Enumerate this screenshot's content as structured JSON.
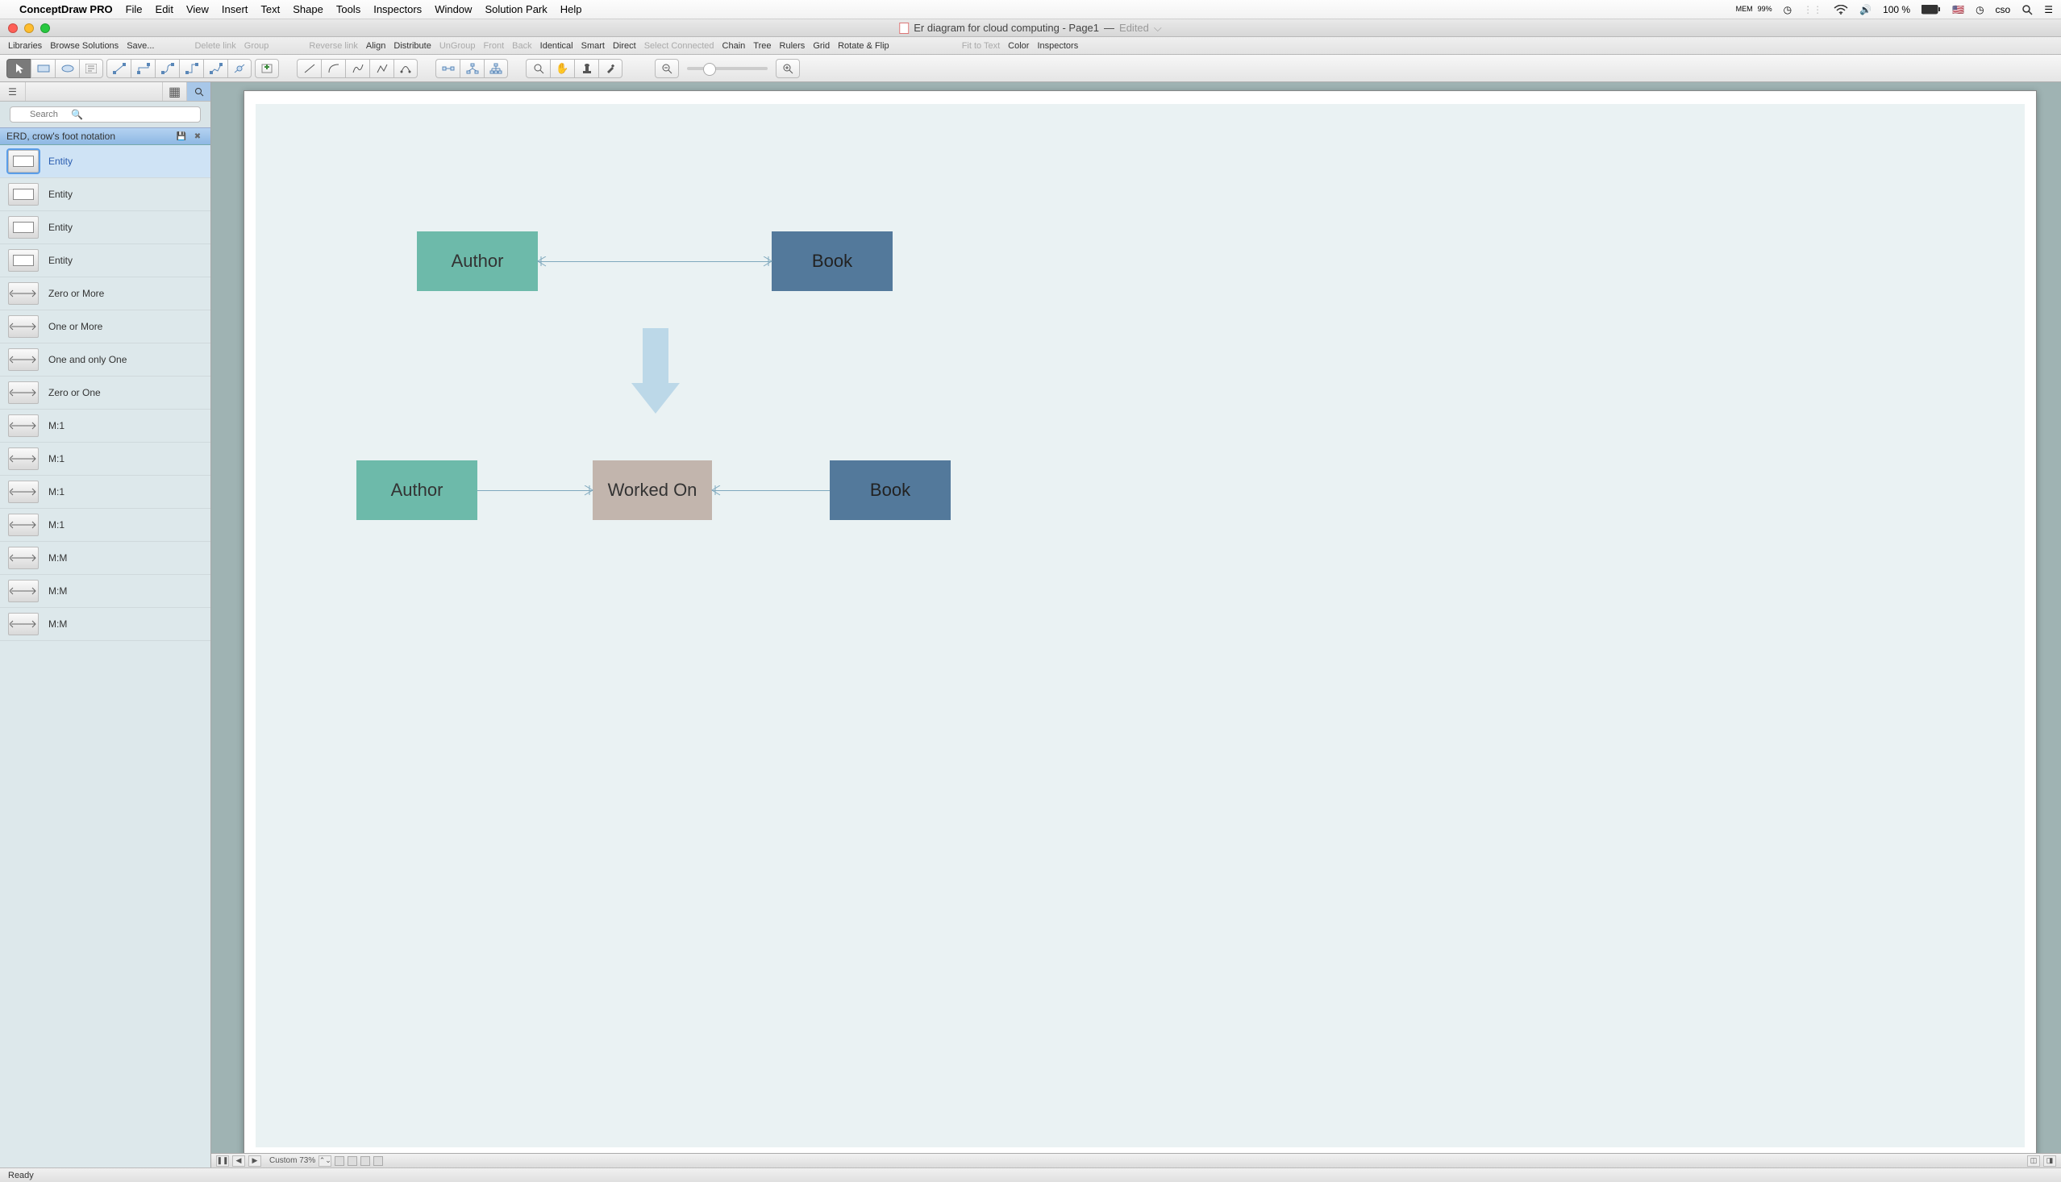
{
  "menubar": {
    "appname": "ConceptDraw PRO",
    "items": [
      "File",
      "Edit",
      "View",
      "Insert",
      "Text",
      "Shape",
      "Tools",
      "Inspectors",
      "Window",
      "Solution Park",
      "Help"
    ],
    "mem_label": "MEM",
    "mem_value": "99%",
    "battery_pct": "100 %",
    "user": "cso"
  },
  "titlebar": {
    "doc_name": "Er diagram for cloud computing - Page1",
    "sep": "—",
    "edited": "Edited"
  },
  "subbar": {
    "libraries": "Libraries",
    "browse": "Browse Solutions",
    "save": "Save...",
    "delete_link": "Delete link",
    "group": "Group",
    "reverse_link": "Reverse link",
    "align": "Align",
    "distribute": "Distribute",
    "ungroup": "UnGroup",
    "front": "Front",
    "back": "Back",
    "identical": "Identical",
    "smart": "Smart",
    "direct": "Direct",
    "select_connected": "Select Connected",
    "chain": "Chain",
    "tree": "Tree",
    "rulers": "Rulers",
    "grid": "Grid",
    "rotate_flip": "Rotate & Flip",
    "fit_to_text": "Fit to Text",
    "color": "Color",
    "inspectors": "Inspectors"
  },
  "sidebar": {
    "search_placeholder": "Search",
    "lib_title": "ERD, crow's foot notation",
    "items": [
      {
        "label": "Entity",
        "selected": true
      },
      {
        "label": "Entity"
      },
      {
        "label": "Entity"
      },
      {
        "label": "Entity"
      },
      {
        "label": "Zero or More"
      },
      {
        "label": "One or More"
      },
      {
        "label": "One and only One"
      },
      {
        "label": "Zero or One"
      },
      {
        "label": "M:1"
      },
      {
        "label": "M:1"
      },
      {
        "label": "M:1"
      },
      {
        "label": "M:1"
      },
      {
        "label": "M:M"
      },
      {
        "label": "M:M"
      },
      {
        "label": "M:M"
      }
    ]
  },
  "canvas": {
    "top_author": "Author",
    "top_book": "Book",
    "bot_author": "Author",
    "worked_on": "Worked On",
    "bot_book": "Book"
  },
  "pagebar": {
    "zoom": "Custom 73%"
  },
  "statusbar": {
    "ready": "Ready"
  },
  "colors": {
    "author": "#6dbaaa",
    "book": "#53799b",
    "worked": "#c2b5ad",
    "page_bg": "#eaf2f3",
    "arrow": "#bcd8e8"
  }
}
